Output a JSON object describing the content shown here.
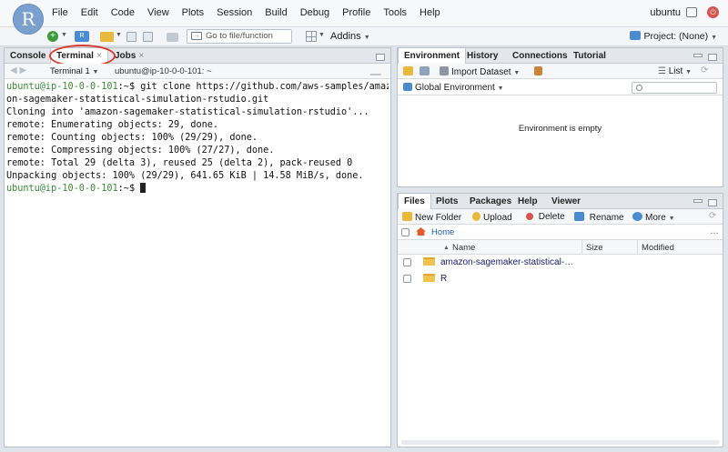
{
  "menubar": {
    "logo": "R",
    "items": [
      "File",
      "Edit",
      "Code",
      "View",
      "Plots",
      "Session",
      "Build",
      "Debug",
      "Profile",
      "Tools",
      "Help"
    ],
    "user": "ubuntu"
  },
  "toolbar": {
    "goto_placeholder": "Go to file/function",
    "addins_label": "Addins",
    "project_label": "Project: (None)"
  },
  "left_pane": {
    "tabs": [
      {
        "label": "Console",
        "active": false,
        "closable": false
      },
      {
        "label": "Terminal",
        "active": true,
        "closable": true
      },
      {
        "label": "Jobs",
        "active": false,
        "closable": true
      }
    ],
    "terminal_selector": "Terminal 1",
    "terminal_title": "ubuntu@ip-10-0-0-101: ~",
    "terminal_lines": [
      {
        "prompt": "ubuntu@ip-10-0-0-101",
        "text": ":~$ git clone https://github.com/aws-samples/amaz"
      },
      {
        "prompt": "",
        "text": "on-sagemaker-statistical-simulation-rstudio.git"
      },
      {
        "prompt": "",
        "text": "Cloning into 'amazon-sagemaker-statistical-simulation-rstudio'..."
      },
      {
        "prompt": "",
        "text": "remote: Enumerating objects: 29, done."
      },
      {
        "prompt": "",
        "text": "remote: Counting objects: 100% (29/29), done."
      },
      {
        "prompt": "",
        "text": "remote: Compressing objects: 100% (27/27), done."
      },
      {
        "prompt": "",
        "text": "remote: Total 29 (delta 3), reused 25 (delta 2), pack-reused 0"
      },
      {
        "prompt": "",
        "text": "Unpacking objects: 100% (29/29), 641.65 KiB | 14.58 MiB/s, done."
      },
      {
        "prompt": "ubuntu@ip-10-0-0-101",
        "text": ":~$ "
      }
    ]
  },
  "env_pane": {
    "tabs": [
      "Environment",
      "History",
      "Connections",
      "Tutorial"
    ],
    "import_label": "Import Dataset",
    "list_label": "List",
    "scope_label": "Global Environment",
    "empty_message": "Environment is empty"
  },
  "files_pane": {
    "tabs": [
      "Files",
      "Plots",
      "Packages",
      "Help",
      "Viewer"
    ],
    "actions": {
      "new_folder": "New Folder",
      "upload": "Upload",
      "delete": "Delete",
      "rename": "Rename",
      "more": "More"
    },
    "breadcrumb": "Home",
    "columns": {
      "name": "Name",
      "size": "Size",
      "modified": "Modified"
    },
    "rows": [
      {
        "name": "amazon-sagemaker-statistical-…"
      },
      {
        "name": "R"
      }
    ]
  },
  "colors": {
    "accent_red": "#d93b2b",
    "prompt_green": "#3a8a3a",
    "link_blue": "#1a5aa8"
  }
}
